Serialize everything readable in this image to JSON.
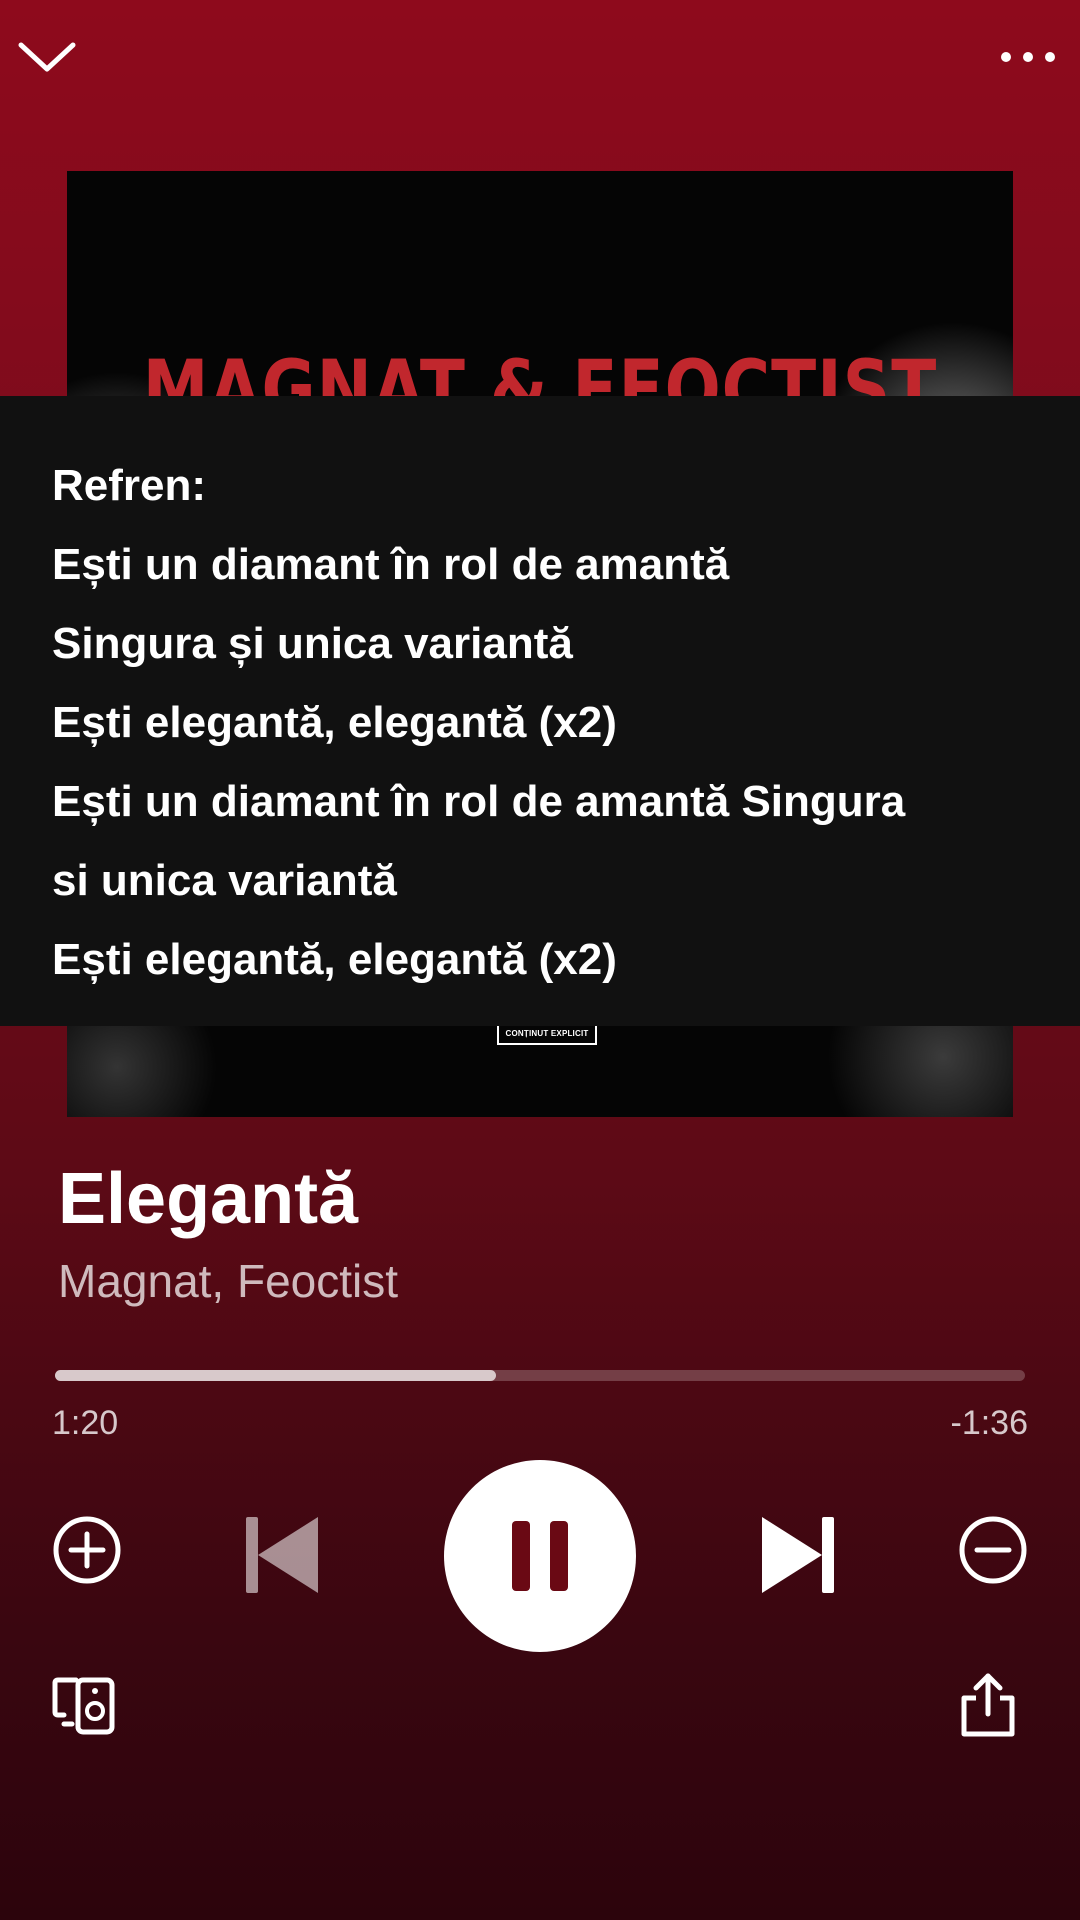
{
  "header": {
    "collapse_icon": "chevron-down-icon",
    "more_icon": "more-horizontal-icon"
  },
  "album_art": {
    "title": "MAGNAT & FEOCTIST",
    "badge": "CONȚINUT EXPLICIT"
  },
  "lyrics": {
    "lines": [
      "Refren:",
      "Ești un diamant în rol de amantă",
      "Singura și unica variantă",
      "Ești elegantă, elegantă (x2)",
      "Ești un diamant în rol de amantă Singura",
      "si unica variantă",
      "Ești elegantă, elegantă (x2)"
    ]
  },
  "track": {
    "title": "Elegantă",
    "artists": "Magnat, Feoctist"
  },
  "playback": {
    "elapsed": "1:20",
    "remaining": "-1:36",
    "progress_fraction": 0.455,
    "state": "playing"
  },
  "controls": {
    "add_icon": "add-circle-icon",
    "previous_icon": "skip-previous-icon",
    "pause_icon": "pause-icon",
    "next_icon": "skip-next-icon",
    "remove_icon": "remove-circle-icon",
    "devices_icon": "connect-devices-icon",
    "share_icon": "share-icon"
  },
  "colors": {
    "background_top": "#8e0a1c",
    "background_bottom": "#2c040c",
    "lyrics_panel": "#111111",
    "album_title_red": "#c1272d"
  }
}
